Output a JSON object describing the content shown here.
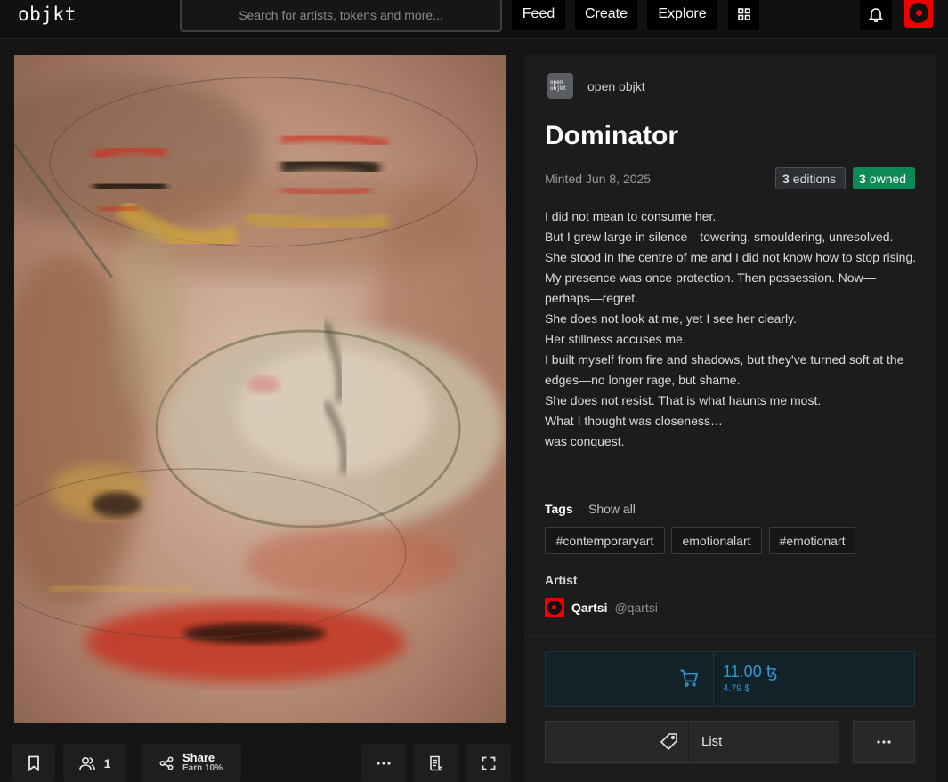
{
  "header": {
    "logo": "objkt",
    "search_placeholder": "Search for artists, tokens and more...",
    "nav": {
      "feed": "Feed",
      "create": "Create",
      "explore": "Explore"
    }
  },
  "art_toolbar": {
    "owners_count": "1",
    "share_label": "Share",
    "share_sub": "Earn 10%"
  },
  "token": {
    "collection_logo": "open_ objkt",
    "collection_name": "open objkt",
    "title": "Dominator",
    "minted": "Minted Jun 8, 2025",
    "editions_count": "3",
    "editions_label": "editions",
    "owned_count": "3",
    "owned_label": "owned",
    "description": [
      "I did not mean to consume her.",
      "But I grew large in silence—towering, smouldering, unresolved.",
      "She stood in the centre of me and I did not know how to stop rising. My presence was once protection. Then possession. Now—perhaps—regret.",
      "She does not look at me, yet I see her clearly.",
      "Her stillness accuses me.",
      "I built myself from fire and shadows, but they've turned soft at the edges—no longer rage, but shame.",
      "She does not resist. That is what haunts me most.",
      "What I thought was closeness…",
      "was conquest."
    ],
    "tags_label": "Tags",
    "show_all": "Show all",
    "tags": [
      "#contemporaryart",
      "emotionalart",
      "#emotionart"
    ],
    "artist_label": "Artist",
    "artist_name": "Qartsi",
    "artist_handle": "@qartsi"
  },
  "market": {
    "price": "11.00 ꜩ",
    "price_usd": "4.79 $",
    "list_label": "List"
  },
  "colors": {
    "accent_price": "#2f9ad0",
    "owned_badge": "#0c8a55",
    "avatar": "#e00000"
  }
}
